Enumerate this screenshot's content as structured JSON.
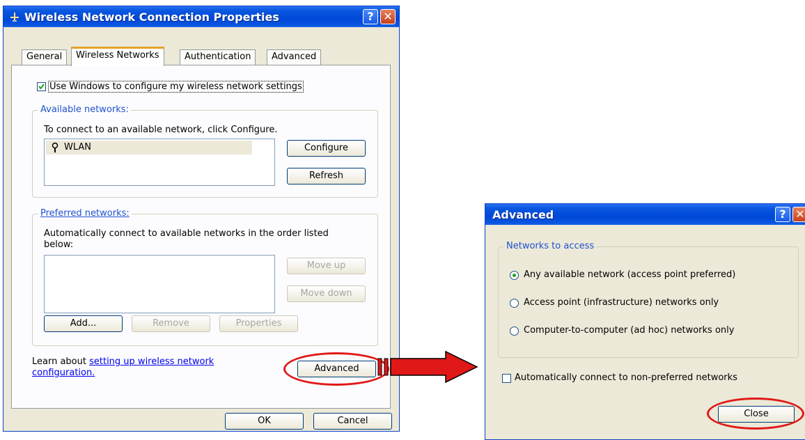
{
  "main_dialog": {
    "title": "Wireless Network Connection Properties",
    "help_label": "?",
    "close_label": "✕",
    "tabs": [
      "General",
      "Wireless Networks",
      "Authentication",
      "Advanced"
    ],
    "use_windows_label": "Use Windows to configure my wireless network settings",
    "use_windows_checked": true,
    "available": {
      "label": "Available networks:",
      "description": "To connect to an available network, click Configure.",
      "networks": [
        "WLAN"
      ],
      "configure_label": "Configure",
      "refresh_label": "Refresh"
    },
    "preferred": {
      "label": "Preferred networks:",
      "description_line1": "Automatically connect to available networks in the order listed",
      "description_line2": "below:",
      "move_up_label": "Move up",
      "move_down_label": "Move down",
      "add_label": "Add...",
      "remove_label": "Remove",
      "properties_label": "Properties"
    },
    "learn_prefix": "Learn about ",
    "learn_link_line1": "setting up wireless network",
    "learn_link_line2": "configuration.",
    "advanced_label": "Advanced",
    "ok_label": "OK",
    "cancel_label": "Cancel"
  },
  "advanced_dialog": {
    "title": "Advanced",
    "help_label": "?",
    "close_label": "✕",
    "group_label": "Networks to access",
    "options": [
      {
        "label": "Any available network (access point preferred)",
        "selected": true
      },
      {
        "label": "Access point (infrastructure) networks only",
        "selected": false
      },
      {
        "label": "Computer-to-computer (ad hoc) networks only",
        "selected": false
      }
    ],
    "auto_connect_label": "Automatically connect to non-preferred networks",
    "auto_connect_checked": false,
    "close_button_label": "Close"
  },
  "colors": {
    "highlight": "#e01818",
    "titlebar": "#0048d8",
    "group_label": "#1f52d0"
  }
}
